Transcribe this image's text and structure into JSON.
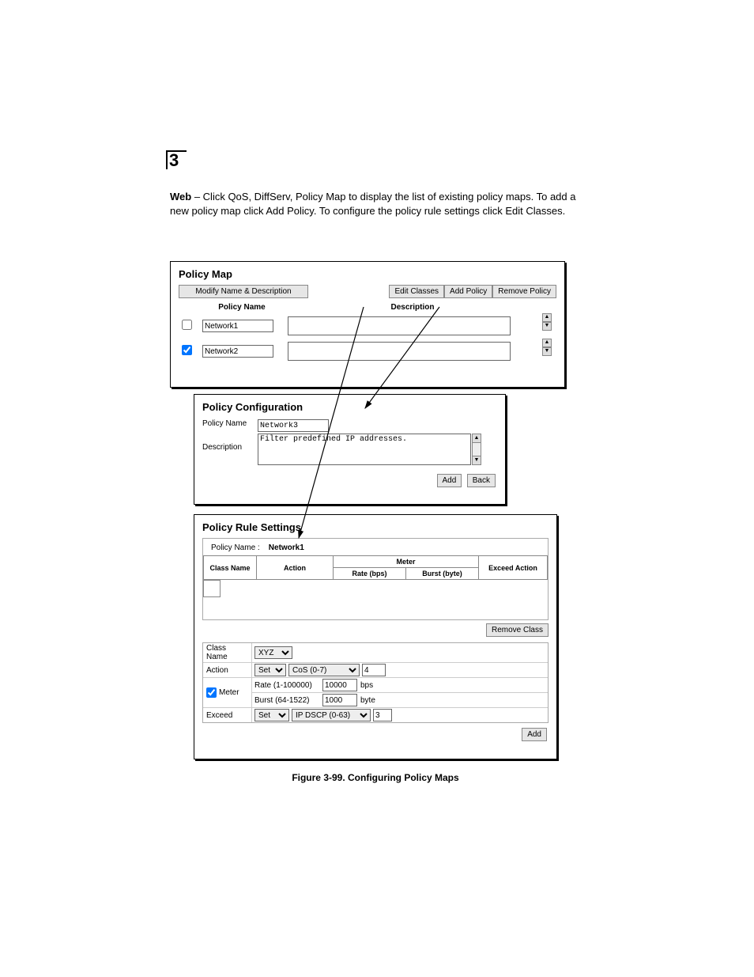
{
  "chapter": "3",
  "intro_prefix_bold": "Web",
  "intro_text": " – Click QoS, DiffServ, Policy Map to display the list of existing policy maps. To add a new policy map click Add Policy. To configure the policy rule settings click Edit Classes.",
  "policy_map": {
    "title": "Policy Map",
    "buttons": {
      "modify": "Modify Name & Description",
      "edit_classes": "Edit Classes",
      "add_policy": "Add Policy",
      "remove_policy": "Remove Policy"
    },
    "columns": {
      "name": "Policy Name",
      "desc": "Description"
    },
    "rows": [
      {
        "checked": false,
        "name": "Network1",
        "desc": ""
      },
      {
        "checked": true,
        "name": "Network2",
        "desc": ""
      }
    ]
  },
  "policy_config": {
    "title": "Policy Configuration",
    "labels": {
      "name": "Policy Name",
      "desc": "Description"
    },
    "name_value": "Network3",
    "desc_value": "Filter predefined IP addresses.",
    "buttons": {
      "add": "Add",
      "back": "Back"
    }
  },
  "policy_rule": {
    "title": "Policy Rule Settings",
    "pname_label": "Policy Name :",
    "pname_value": "Network1",
    "columns": {
      "class_name": "Class Name",
      "action": "Action",
      "meter": "Meter",
      "rate": "Rate (bps)",
      "burst": "Burst (byte)",
      "exceed": "Exceed Action"
    },
    "remove_class": "Remove Class",
    "form": {
      "class_name_label": "Class Name",
      "class_name_value": "XYZ",
      "action_label": "Action",
      "action_set": "Set",
      "action_cos": "CoS (0-7)",
      "action_value": "4",
      "meter_label": "Meter",
      "meter_checked": true,
      "rate_label": "Rate (1-100000)",
      "rate_value": "10000",
      "rate_unit": "bps",
      "burst_label": "Burst (64-1522)",
      "burst_value": "1000",
      "burst_unit": "byte",
      "exceed_label": "Exceed",
      "exceed_set": "Set",
      "exceed_dscp": "IP DSCP (0-63)",
      "exceed_value": "3",
      "add": "Add"
    }
  },
  "figure_caption": "Figure 3-99.  Configuring Policy Maps"
}
